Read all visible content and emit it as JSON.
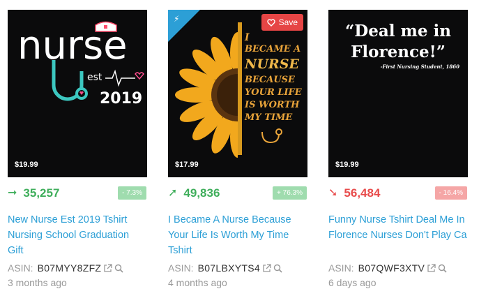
{
  "colors": {
    "accent": "#2c9fd6",
    "up": "#3fae5b",
    "down": "#e84b4b",
    "save": "#e64545"
  },
  "asin_label": "ASIN:",
  "products": [
    {
      "price": "$19.99",
      "rank": "35,257",
      "trend": "flat",
      "change": "- 7.3%",
      "title": "New Nurse Est 2019 Tshirt Nursing School Graduation Gift",
      "asin": "B07MYY8ZFZ",
      "age": "3 months ago",
      "art": {
        "line1": "nurse",
        "line2": "est",
        "year": "2019"
      }
    },
    {
      "price": "$17.99",
      "rank": "49,836",
      "trend": "up",
      "change": "+ 76.3%",
      "title": "I Became A Nurse Because Your Life Is Worth My Time Tshirt",
      "asin": "B07LBXYTS4",
      "age": "4 months ago",
      "save_label": "Save",
      "art": {
        "lines": [
          "I",
          "BECAME A",
          "NURSE",
          "BECAUSE",
          "YOUR LIFE",
          "IS WORTH",
          "MY TIME"
        ]
      }
    },
    {
      "price": "$19.99",
      "rank": "56,484",
      "trend": "down",
      "change": "- 16.4%",
      "title": "Funny Nurse Tshirt Deal Me In Florence Nurses Don't Play Ca",
      "asin": "B07QWF3XTV",
      "age": "6 days ago",
      "art": {
        "quote1": "“Deal me in",
        "quote2": "Florence!”",
        "attribution": "-First Nursing Student, 1860"
      }
    }
  ]
}
